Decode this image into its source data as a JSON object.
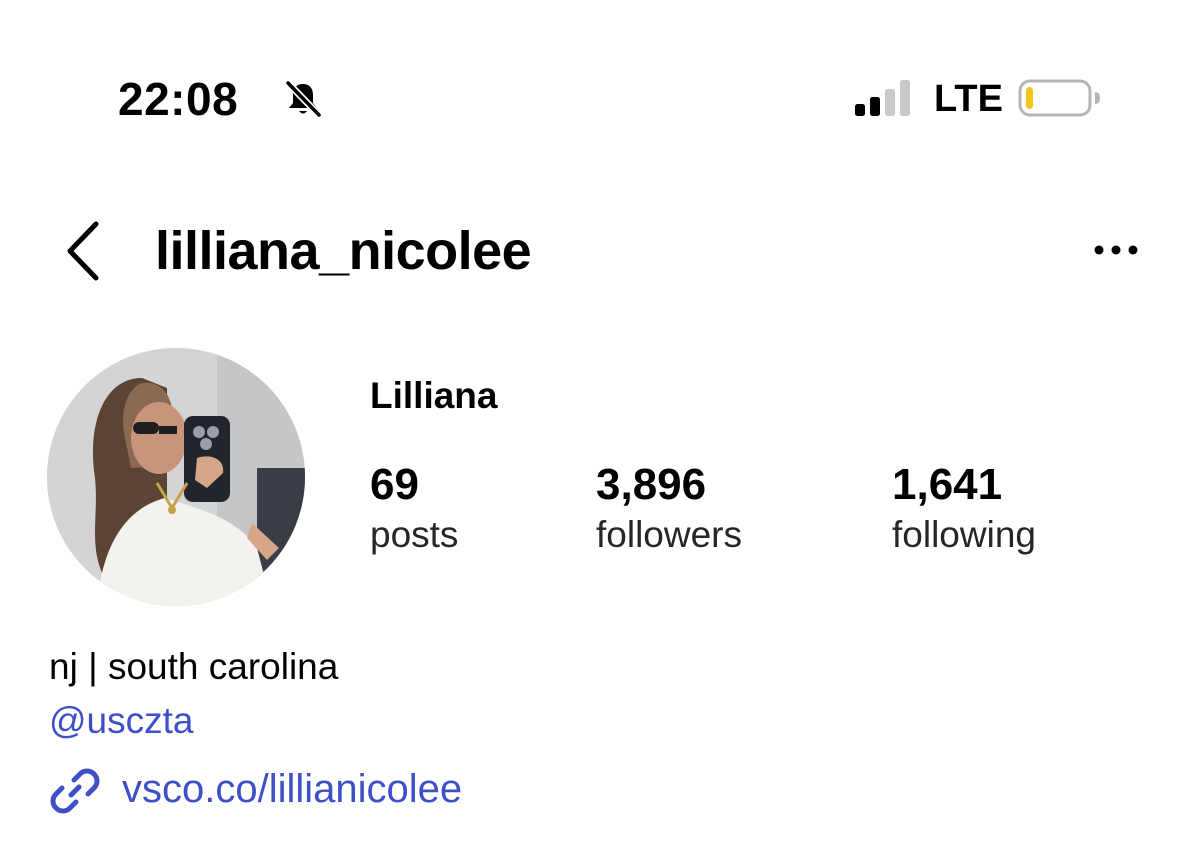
{
  "status_bar": {
    "time": "22:08",
    "silent_icon": "bell-slash-icon",
    "signal_icon": "cellular-signal-icon",
    "signal_bars_active": 2,
    "signal_bars_total": 4,
    "network": "LTE",
    "battery_icon": "battery-low-icon",
    "battery_level": 0.12,
    "battery_color": "#f5c518"
  },
  "header": {
    "back_icon": "chevron-left-icon",
    "username": "lilliana_nicolee",
    "more_icon": "more-horizontal-icon"
  },
  "profile": {
    "avatar_icon": "profile-photo",
    "display_name": "Lilliana",
    "stats": [
      {
        "value": "69",
        "label": "posts"
      },
      {
        "value": "3,896",
        "label": "followers"
      },
      {
        "value": "1,641",
        "label": "following"
      }
    ]
  },
  "bio": {
    "location": "nj | south carolina",
    "mention": "@usczta",
    "link_icon": "link-icon",
    "link": "vsco.co/lillianicolee"
  },
  "colors": {
    "link": "#3e4fc8",
    "text": "#000000",
    "background": "#ffffff"
  }
}
